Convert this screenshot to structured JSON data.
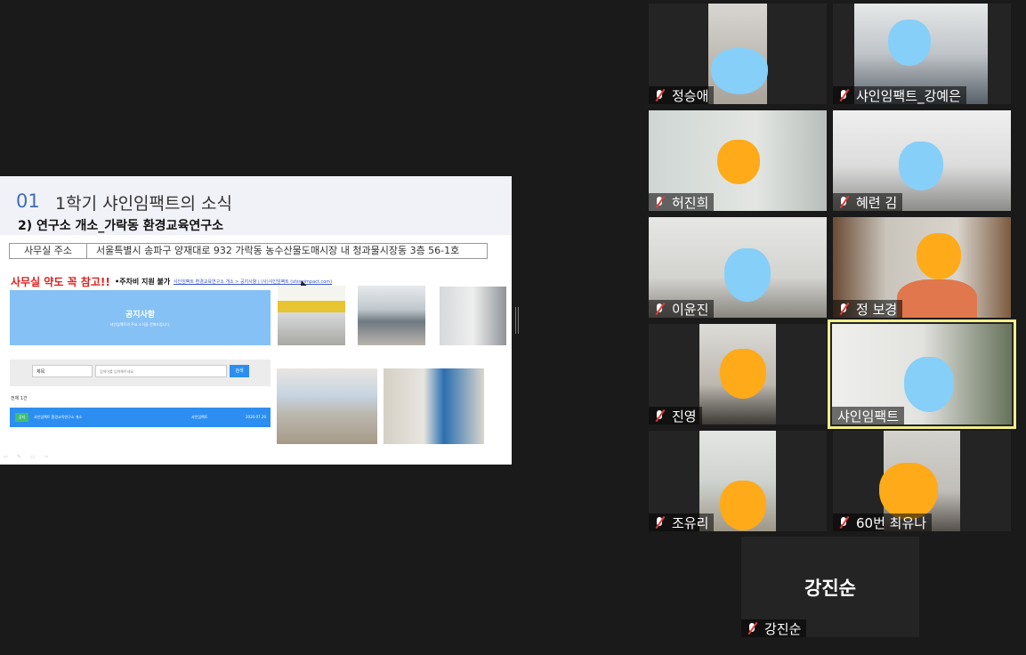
{
  "slide": {
    "number": "01",
    "title": "1학기 샤인임팩트의 소식",
    "subtitle": "2) 연구소 개소_가락동 환경교육연구소",
    "address_label": "사무실 주소",
    "address_value": "서울특별시 송파구 양재대로 932 가락동 농수산물도매시장 내 청과물시장동 3층 56-1호",
    "notice": "사무실 약도 꼭 참고!!",
    "parking": "•주차비 지원 불가",
    "link": "샤인임팩트 환경교육연구소 개소 > 공지사항 | (사)샤인임팩트 (shineimpact.com)",
    "board": {
      "banner_title": "공지사항",
      "banner_sub": "샤인임팩트의 주요 소식을 전해드립니다.",
      "select_value": "제목",
      "search_placeholder": "검색어를 입력해주세요",
      "search_button": "검색",
      "total": "전체 1건",
      "row": {
        "tag": "공지",
        "title": "샤인임팩트 환경교육연구소 개소",
        "author": "샤인임팩트",
        "date": "2020.07.29"
      }
    },
    "controls": "⇦ ✎ ▭ ⇨"
  },
  "participants": [
    {
      "name": "정승애",
      "muted": true
    },
    {
      "name": "샤인임팩트_강예은",
      "muted": true
    },
    {
      "name": "허진희",
      "muted": true
    },
    {
      "name": "혜련 김",
      "muted": true
    },
    {
      "name": "이윤진",
      "muted": true
    },
    {
      "name": "정 보경",
      "muted": true
    },
    {
      "name": "진영",
      "muted": true
    },
    {
      "name": "샤인임팩트",
      "muted": false,
      "active_speaker": true
    },
    {
      "name": "조유리",
      "muted": true
    },
    {
      "name": "60번 최유나",
      "muted": true
    },
    {
      "name": "강진순",
      "muted": true,
      "video_off": true
    }
  ],
  "colors": {
    "active_border": "#f2ee8a",
    "blue_mask": "#86cff8",
    "orange_mask": "#ffaa19",
    "muted_icon": "#e23b3b"
  }
}
